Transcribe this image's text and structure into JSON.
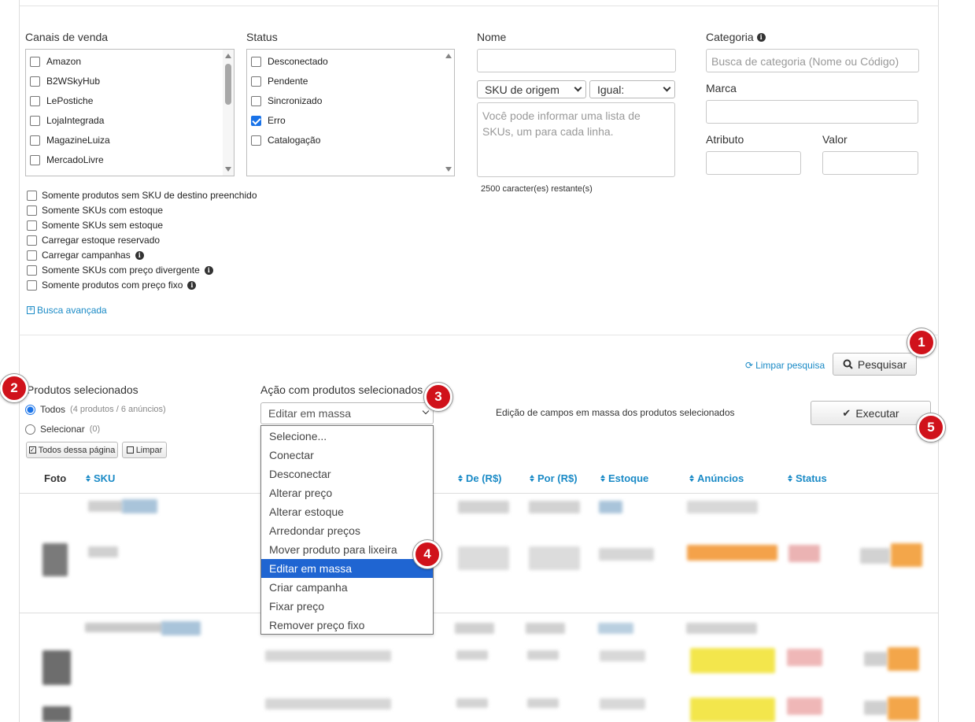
{
  "filters": {
    "sales_channels": {
      "label": "Canais de venda",
      "items": [
        {
          "label": "Amazon",
          "checked": false
        },
        {
          "label": "B2WSkyHub",
          "checked": false
        },
        {
          "label": "LePostiche",
          "checked": false
        },
        {
          "label": "LojaIntegrada",
          "checked": false
        },
        {
          "label": "MagazineLuiza",
          "checked": false
        },
        {
          "label": "MercadoLivre",
          "checked": false
        }
      ]
    },
    "status": {
      "label": "Status",
      "items": [
        {
          "label": "Desconectado",
          "checked": false
        },
        {
          "label": "Pendente",
          "checked": false
        },
        {
          "label": "Sincronizado",
          "checked": false
        },
        {
          "label": "Erro",
          "checked": true
        },
        {
          "label": "Catalogação",
          "checked": false
        }
      ]
    },
    "name": {
      "label": "Nome",
      "value": "",
      "sku_field_select": "SKU de origem",
      "operator_select": "Igual:",
      "sku_list_placeholder": "Você pode informar uma lista de SKUs, um para cada linha.",
      "chars_remaining": "2500 caracter(es) restante(s)"
    },
    "category": {
      "label": "Categoria",
      "placeholder": "Busca de categoria (Nome ou Código)"
    },
    "brand": {
      "label": "Marca",
      "value": ""
    },
    "attribute": {
      "label": "Atributo",
      "value": ""
    },
    "value": {
      "label": "Valor",
      "value": ""
    },
    "options": [
      {
        "label": "Somente produtos sem SKU de destino preenchido",
        "info": false
      },
      {
        "label": "Somente SKUs com estoque",
        "info": false
      },
      {
        "label": "Somente SKUs sem estoque",
        "info": false
      },
      {
        "label": "Carregar estoque reservado",
        "info": false
      },
      {
        "label": "Carregar campanhas",
        "info": true
      },
      {
        "label": "Somente SKUs com preço divergente",
        "info": true
      },
      {
        "label": "Somente produtos com preço fixo",
        "info": true
      }
    ],
    "advanced_search": "Busca avançada",
    "clear_search": "Limpar pesquisa",
    "search_button": "Pesquisar"
  },
  "selection": {
    "label": "Produtos selecionados",
    "all_label": "Todos",
    "all_count": "(4 produtos / 6 anúncios)",
    "select_label": "Selecionar",
    "select_count": "(0)",
    "all_page_button": "Todos dessa página",
    "clear_button": "Limpar"
  },
  "action": {
    "label": "Ação com produtos selecionados",
    "selected": "Editar em massa",
    "description": "Edição de campos em massa dos produtos selecionados",
    "execute_button": "Executar",
    "options": [
      "Selecione...",
      "Conectar",
      "Desconectar",
      "Alterar preço",
      "Alterar estoque",
      "Arredondar preços",
      "Mover produto para lixeira",
      "Editar em massa",
      "Criar campanha",
      "Fixar preço",
      "Remover preço fixo"
    ],
    "highlighted_index": 7
  },
  "table": {
    "headers": {
      "photo": "Foto",
      "sku": "SKU",
      "from": "De (R$)",
      "to": "Por (R$)",
      "stock": "Estoque",
      "listings": "Anúncios",
      "status": "Status"
    }
  },
  "badges": [
    "1",
    "2",
    "3",
    "4",
    "5"
  ],
  "colors": {
    "link": "#1a8ac6",
    "badge": "#d0121b",
    "highlight": "#1f65d2"
  }
}
